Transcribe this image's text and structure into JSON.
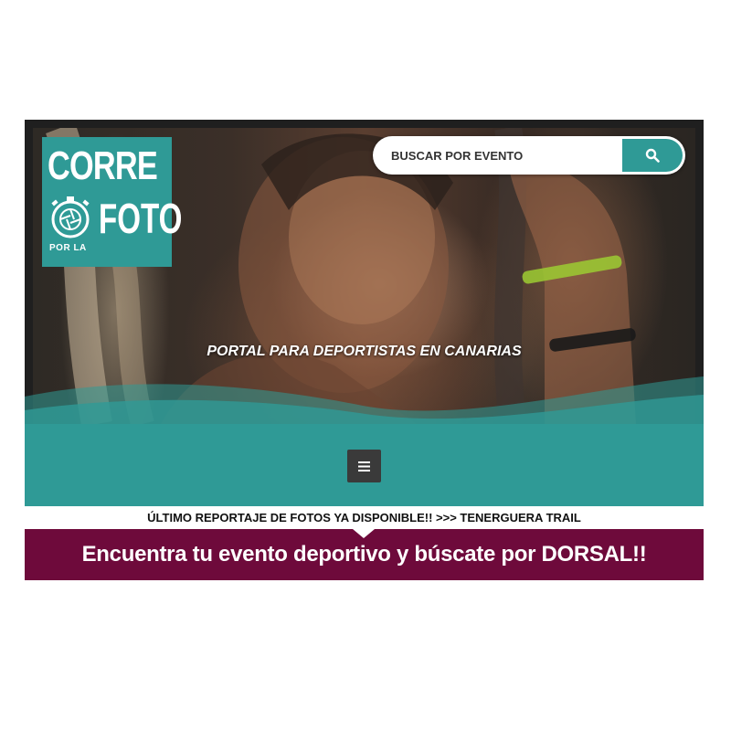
{
  "hero": {
    "logo": {
      "line1": "CORRE",
      "line2": "FOTO",
      "small_text": "POR LA"
    },
    "search": {
      "placeholder": "BUSCAR POR EVENTO",
      "button_icon": "search-icon"
    },
    "tagline": "PORTAL PARA DEPORTISTAS EN CANARIAS"
  },
  "nav": {
    "menu_icon": "hamburger-menu-icon"
  },
  "ticker": {
    "text": "ÚLTIMO REPORTAJE DE FOTOS YA DISPONIBLE!! >>> TENERGUERA TRAIL"
  },
  "banner": {
    "text": "Encuentra tu evento deportivo y búscate por DORSAL!!"
  },
  "colors": {
    "teal": "#2f9a96",
    "maroon": "#6e0a3b",
    "dark_frame": "#1f1f1f",
    "menu_button": "#3a3a3a"
  }
}
